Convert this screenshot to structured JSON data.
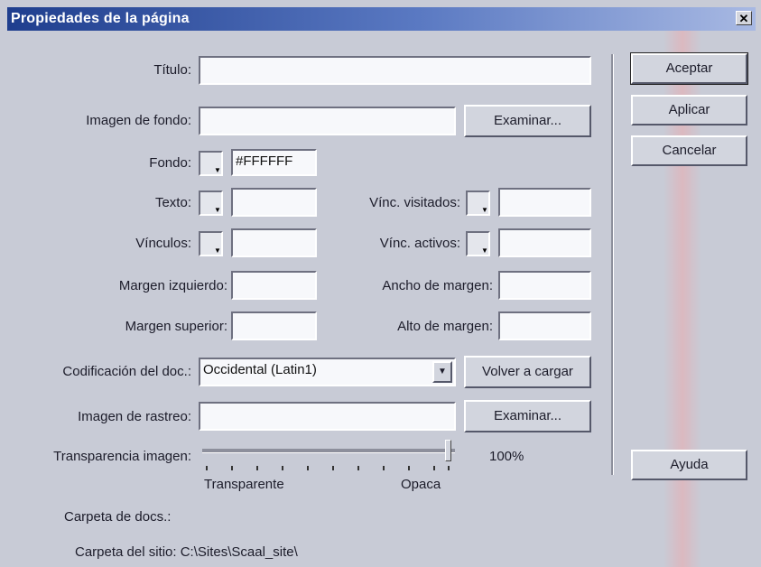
{
  "window": {
    "title": "Propiedades de la página",
    "close": "✕"
  },
  "labels": {
    "titulo": "Título:",
    "imagen_fondo": "Imagen de fondo:",
    "fondo": "Fondo:",
    "texto": "Texto:",
    "vinculos": "Vínculos:",
    "vinc_visitados": "Vínc. visitados:",
    "vinc_activos": "Vínc. activos:",
    "margen_izquierdo": "Margen izquierdo:",
    "ancho_margen": "Ancho de margen:",
    "margen_superior": "Margen superior:",
    "alto_margen": "Alto de margen:",
    "codificacion": "Codificación del doc.:",
    "imagen_rastreo": "Imagen de rastreo:",
    "transparencia": "Transparencia imagen:",
    "transparente": "Transparente",
    "opaca": "Opaca",
    "carpeta_docs": "Carpeta de docs.:",
    "carpeta_sitio": "Carpeta del sitio: C:\\Sites\\Scaal_site\\"
  },
  "fields": {
    "titulo": "",
    "imagen_fondo": "",
    "fondo_color": "#FFFFFF",
    "texto_color": "",
    "vinculos_color": "",
    "vinc_visitados_color": "",
    "vinc_activos_color": "",
    "margen_izquierdo": "",
    "ancho_margen": "",
    "margen_superior": "",
    "alto_margen": "",
    "codificacion": "Occidental (Latin1)",
    "imagen_rastreo": ""
  },
  "slider": {
    "value_label": "100%",
    "value": 1.0
  },
  "buttons": {
    "aceptar": "Aceptar",
    "aplicar": "Aplicar",
    "cancelar": "Cancelar",
    "examinar1": "Examinar...",
    "volver_cargar": "Volver a cargar",
    "examinar2": "Examinar...",
    "ayuda": "Ayuda"
  },
  "icons": {
    "close": "close-icon",
    "dropdown": "chevron-down-icon"
  }
}
